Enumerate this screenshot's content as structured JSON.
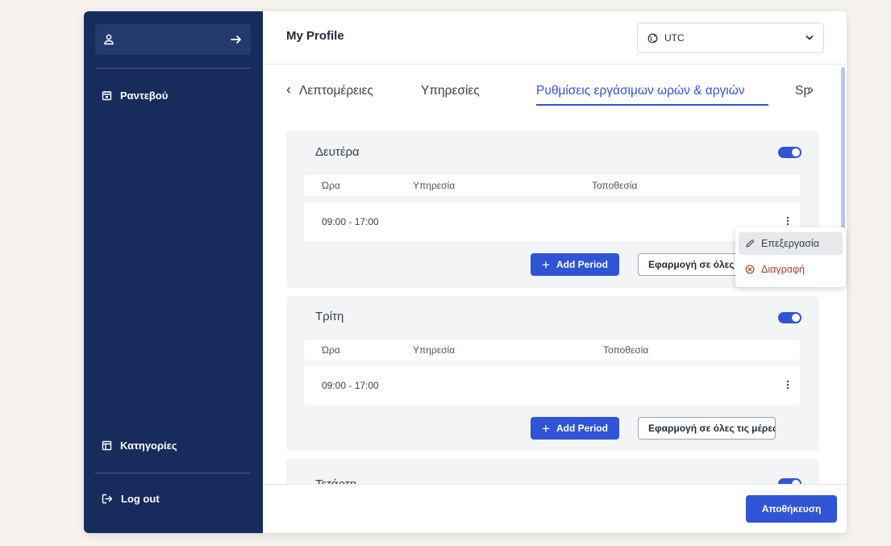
{
  "sidebar": {
    "items": [
      {
        "label": "Ραντεβού",
        "icon": "calendar-icon"
      },
      {
        "label": "Κατηγορίες",
        "icon": "layout-icon"
      },
      {
        "label": "Log out",
        "icon": "logout-icon"
      }
    ]
  },
  "header": {
    "title": "My Profile",
    "timezone": "UTC"
  },
  "tabs": [
    {
      "label": "Λεπτομέρειες",
      "active": false
    },
    {
      "label": "Υπηρεσίες",
      "active": false
    },
    {
      "label": "Ρυθμίσεις εργάσιμων ωρών & αργιών",
      "active": true
    },
    {
      "label": "Spec",
      "active": false
    }
  ],
  "table_headers": {
    "time": "Ώρα",
    "service": "Υπηρεσία",
    "location": "Τοποθεσία"
  },
  "days": [
    {
      "name": "Δευτέρα",
      "enabled": true,
      "periods": [
        "09:00 - 17:00"
      ],
      "apply_label": "Εφαρμογή σε όλες τις μέρες"
    },
    {
      "name": "Τρίτη",
      "enabled": true,
      "periods": [
        "09:00 - 17:00"
      ],
      "apply_label": "Εφαρμογή σε όλες τις μέρες"
    },
    {
      "name": "Τετάρτη",
      "enabled": true,
      "periods": []
    }
  ],
  "add_period_label": "Add Period",
  "context_menu": {
    "edit": "Επεξεργασία",
    "delete": "Διαγραφή"
  },
  "footer": {
    "save_label": "Αποθήκευση"
  },
  "colors": {
    "sidebar": "#172b5c",
    "accent": "#2f54d6",
    "danger": "#c0392b"
  }
}
